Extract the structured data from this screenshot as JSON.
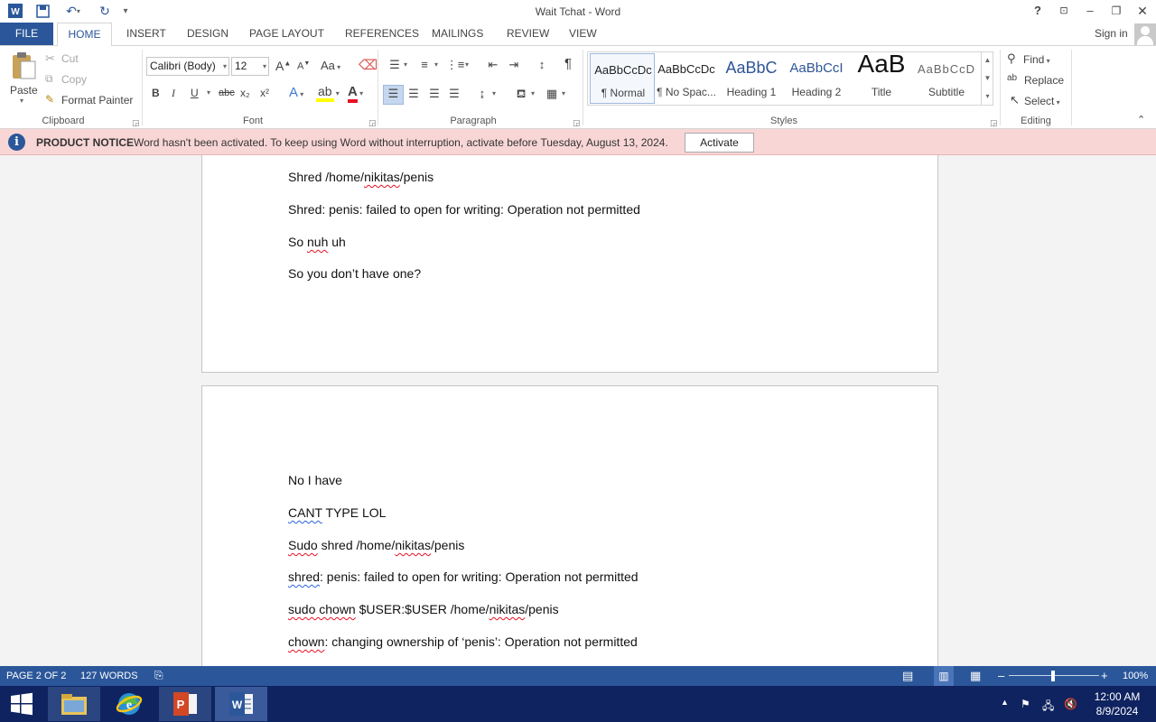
{
  "window": {
    "title": "Wait Tchat - Word"
  },
  "tabs": {
    "file": "FILE",
    "items": [
      "HOME",
      "INSERT",
      "DESIGN",
      "PAGE LAYOUT",
      "REFERENCES",
      "MAILINGS",
      "REVIEW",
      "VIEW"
    ],
    "sign_in": "Sign in"
  },
  "ribbon": {
    "clipboard": {
      "paste": "Paste",
      "cut": "Cut",
      "copy": "Copy",
      "format_painter": "Format Painter",
      "label": "Clipboard"
    },
    "font": {
      "family": "Calibri (Body)",
      "size": "12",
      "label": "Font",
      "change_case": "Aa",
      "bold": "B",
      "italic": "I",
      "underline": "U",
      "strike": "abc",
      "sub": "x₂",
      "sup": "x²",
      "grow": "A",
      "shrink": "A",
      "font_color": "A",
      "effects": "A"
    },
    "paragraph": {
      "label": "Paragraph",
      "pilcrow": "¶"
    },
    "styles": {
      "label": "Styles",
      "items": [
        {
          "preview": "AaBbCcDc",
          "name": "¶ Normal"
        },
        {
          "preview": "AaBbCcDc",
          "name": "¶ No Spac..."
        },
        {
          "preview": "AaBbC",
          "name": "Heading 1"
        },
        {
          "preview": "AaBbCcI",
          "name": "Heading 2"
        },
        {
          "preview": "AaB",
          "name": "Title"
        },
        {
          "preview": "AaBbCcD",
          "name": "Subtitle"
        }
      ]
    },
    "editing": {
      "find": "Find",
      "replace": "Replace",
      "select": "Select",
      "label": "Editing"
    }
  },
  "notice": {
    "title": "PRODUCT NOTICE",
    "message": "Word hasn't been activated. To keep using Word without interruption, activate before Tuesday, August 13, 2024.",
    "button": "Activate"
  },
  "document": {
    "page1": [
      {
        "pre": "Shred /home/",
        "sq": "nikitas",
        "post": "/penis"
      },
      {
        "pre": "Shred: penis: failed to open for writing: Operation not permitted"
      },
      {
        "pre": "So ",
        "sq": "nuh",
        "post": " uh"
      },
      {
        "pre": "So you don’t have one?"
      }
    ],
    "page2": [
      {
        "pre": "No I have"
      },
      {
        "bq": "CANT",
        "post": " TYPE LOL"
      },
      {
        "bq": "Sudo",
        "post": " shred /home/",
        "sq": "nikitas",
        "post2": "/penis"
      },
      {
        "bq": "shred",
        "post": ": penis: failed to open for writing: Operation not permitted"
      },
      {
        "sq": "sudo chown",
        "post": " $USER:$USER /home/",
        "sq2": "nikitas",
        "post2": "/penis"
      },
      {
        "sq": "chown",
        "post": ": changing ownership of ‘penis’: Operation not permitted"
      }
    ]
  },
  "status": {
    "page": "PAGE 2 OF 2",
    "words": "127 WORDS",
    "zoom": "100%"
  },
  "taskbar": {
    "time": "12:00 AM",
    "date": "8/9/2024"
  },
  "colors": {
    "word_blue": "#2b579a",
    "notice_bg": "#f9d6d6",
    "taskbar": "#0f2360"
  }
}
